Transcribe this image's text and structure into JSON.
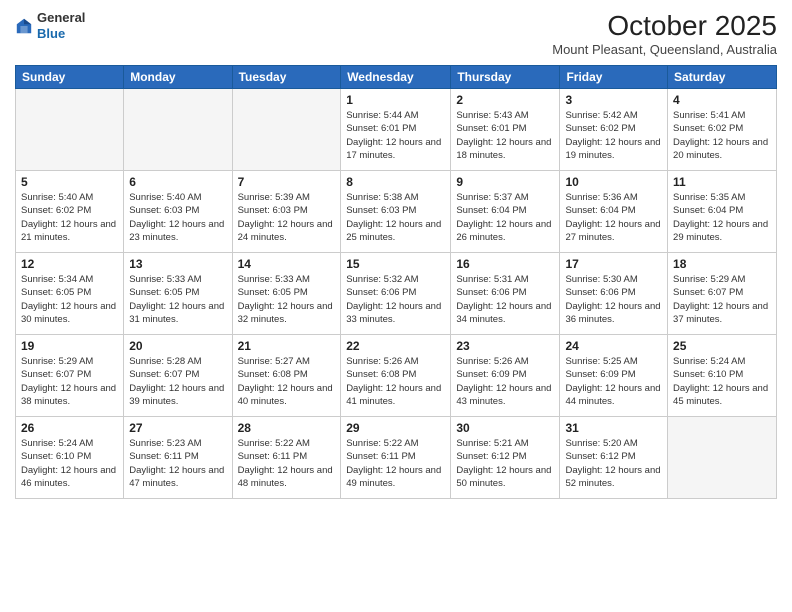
{
  "header": {
    "logo_general": "General",
    "logo_blue": "Blue",
    "month": "October 2025",
    "location": "Mount Pleasant, Queensland, Australia"
  },
  "days_of_week": [
    "Sunday",
    "Monday",
    "Tuesday",
    "Wednesday",
    "Thursday",
    "Friday",
    "Saturday"
  ],
  "weeks": [
    [
      {
        "day": "",
        "info": ""
      },
      {
        "day": "",
        "info": ""
      },
      {
        "day": "",
        "info": ""
      },
      {
        "day": "1",
        "info": "Sunrise: 5:44 AM\nSunset: 6:01 PM\nDaylight: 12 hours\nand 17 minutes."
      },
      {
        "day": "2",
        "info": "Sunrise: 5:43 AM\nSunset: 6:01 PM\nDaylight: 12 hours\nand 18 minutes."
      },
      {
        "day": "3",
        "info": "Sunrise: 5:42 AM\nSunset: 6:02 PM\nDaylight: 12 hours\nand 19 minutes."
      },
      {
        "day": "4",
        "info": "Sunrise: 5:41 AM\nSunset: 6:02 PM\nDaylight: 12 hours\nand 20 minutes."
      }
    ],
    [
      {
        "day": "5",
        "info": "Sunrise: 5:40 AM\nSunset: 6:02 PM\nDaylight: 12 hours\nand 21 minutes."
      },
      {
        "day": "6",
        "info": "Sunrise: 5:40 AM\nSunset: 6:03 PM\nDaylight: 12 hours\nand 23 minutes."
      },
      {
        "day": "7",
        "info": "Sunrise: 5:39 AM\nSunset: 6:03 PM\nDaylight: 12 hours\nand 24 minutes."
      },
      {
        "day": "8",
        "info": "Sunrise: 5:38 AM\nSunset: 6:03 PM\nDaylight: 12 hours\nand 25 minutes."
      },
      {
        "day": "9",
        "info": "Sunrise: 5:37 AM\nSunset: 6:04 PM\nDaylight: 12 hours\nand 26 minutes."
      },
      {
        "day": "10",
        "info": "Sunrise: 5:36 AM\nSunset: 6:04 PM\nDaylight: 12 hours\nand 27 minutes."
      },
      {
        "day": "11",
        "info": "Sunrise: 5:35 AM\nSunset: 6:04 PM\nDaylight: 12 hours\nand 29 minutes."
      }
    ],
    [
      {
        "day": "12",
        "info": "Sunrise: 5:34 AM\nSunset: 6:05 PM\nDaylight: 12 hours\nand 30 minutes."
      },
      {
        "day": "13",
        "info": "Sunrise: 5:33 AM\nSunset: 6:05 PM\nDaylight: 12 hours\nand 31 minutes."
      },
      {
        "day": "14",
        "info": "Sunrise: 5:33 AM\nSunset: 6:05 PM\nDaylight: 12 hours\nand 32 minutes."
      },
      {
        "day": "15",
        "info": "Sunrise: 5:32 AM\nSunset: 6:06 PM\nDaylight: 12 hours\nand 33 minutes."
      },
      {
        "day": "16",
        "info": "Sunrise: 5:31 AM\nSunset: 6:06 PM\nDaylight: 12 hours\nand 34 minutes."
      },
      {
        "day": "17",
        "info": "Sunrise: 5:30 AM\nSunset: 6:06 PM\nDaylight: 12 hours\nand 36 minutes."
      },
      {
        "day": "18",
        "info": "Sunrise: 5:29 AM\nSunset: 6:07 PM\nDaylight: 12 hours\nand 37 minutes."
      }
    ],
    [
      {
        "day": "19",
        "info": "Sunrise: 5:29 AM\nSunset: 6:07 PM\nDaylight: 12 hours\nand 38 minutes."
      },
      {
        "day": "20",
        "info": "Sunrise: 5:28 AM\nSunset: 6:07 PM\nDaylight: 12 hours\nand 39 minutes."
      },
      {
        "day": "21",
        "info": "Sunrise: 5:27 AM\nSunset: 6:08 PM\nDaylight: 12 hours\nand 40 minutes."
      },
      {
        "day": "22",
        "info": "Sunrise: 5:26 AM\nSunset: 6:08 PM\nDaylight: 12 hours\nand 41 minutes."
      },
      {
        "day": "23",
        "info": "Sunrise: 5:26 AM\nSunset: 6:09 PM\nDaylight: 12 hours\nand 43 minutes."
      },
      {
        "day": "24",
        "info": "Sunrise: 5:25 AM\nSunset: 6:09 PM\nDaylight: 12 hours\nand 44 minutes."
      },
      {
        "day": "25",
        "info": "Sunrise: 5:24 AM\nSunset: 6:10 PM\nDaylight: 12 hours\nand 45 minutes."
      }
    ],
    [
      {
        "day": "26",
        "info": "Sunrise: 5:24 AM\nSunset: 6:10 PM\nDaylight: 12 hours\nand 46 minutes."
      },
      {
        "day": "27",
        "info": "Sunrise: 5:23 AM\nSunset: 6:11 PM\nDaylight: 12 hours\nand 47 minutes."
      },
      {
        "day": "28",
        "info": "Sunrise: 5:22 AM\nSunset: 6:11 PM\nDaylight: 12 hours\nand 48 minutes."
      },
      {
        "day": "29",
        "info": "Sunrise: 5:22 AM\nSunset: 6:11 PM\nDaylight: 12 hours\nand 49 minutes."
      },
      {
        "day": "30",
        "info": "Sunrise: 5:21 AM\nSunset: 6:12 PM\nDaylight: 12 hours\nand 50 minutes."
      },
      {
        "day": "31",
        "info": "Sunrise: 5:20 AM\nSunset: 6:12 PM\nDaylight: 12 hours\nand 52 minutes."
      },
      {
        "day": "",
        "info": ""
      }
    ]
  ]
}
